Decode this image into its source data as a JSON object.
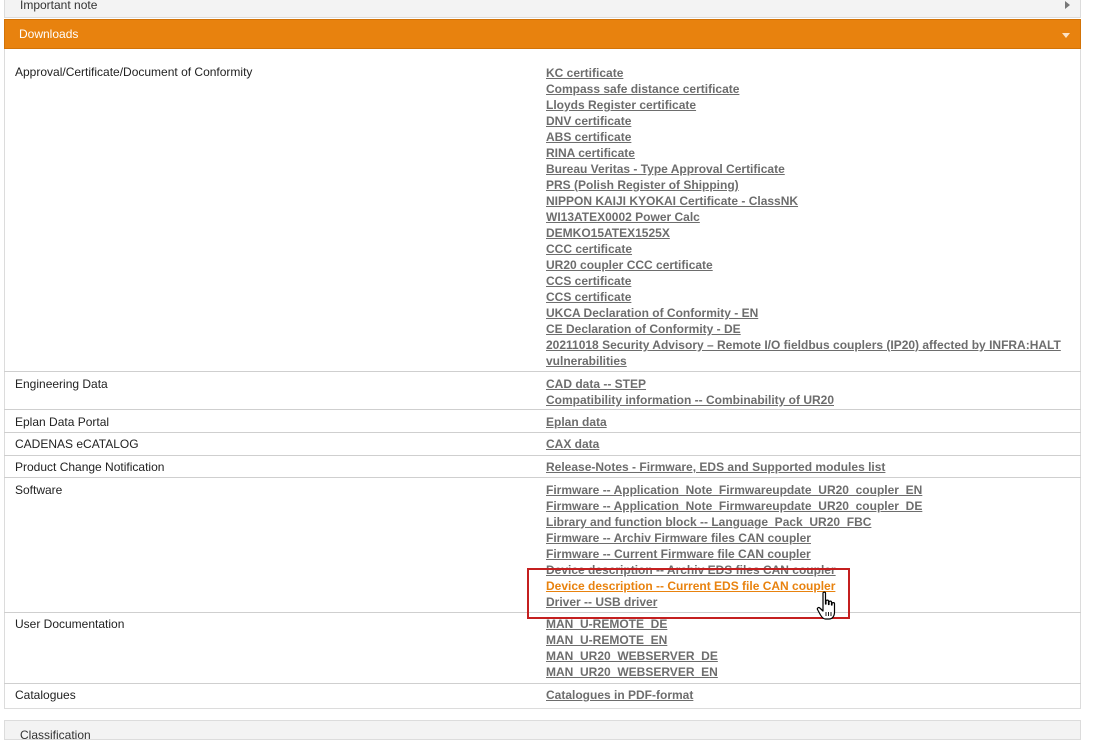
{
  "note_bar": {
    "label": "Important note"
  },
  "downloads_bar": {
    "label": "Downloads"
  },
  "rows": {
    "approval": {
      "label": "Approval/Certificate/Document of Conformity",
      "links": [
        "KC certificate",
        "Compass safe distance certificate",
        "Lloyds Register certificate",
        "DNV certificate",
        "ABS certificate",
        "RINA certificate",
        "Bureau Veritas - Type Approval Certificate",
        "PRS (Polish Register of Shipping)",
        "NIPPON KAIJI KYOKAI Certificate - ClassNK",
        "WI13ATEX0002 Power Calc",
        "DEMKO15ATEX1525X",
        "CCC certificate",
        "UR20 coupler CCC certificate",
        "CCS certificate",
        "CCS certificate",
        "UKCA Declaration of Conformity - EN",
        "CE Declaration of Conformity - DE",
        "20211018 Security Advisory – Remote I/O fieldbus couplers (IP20) affected by INFRA:HALT vulnerabilities"
      ]
    },
    "engineering": {
      "label": "Engineering Data",
      "links": [
        "CAD data -- STEP",
        "Compatibility information -- Combinability of UR20"
      ]
    },
    "eplan": {
      "label": "Eplan Data Portal",
      "links": [
        "Eplan data"
      ]
    },
    "cadenas": {
      "label": "CADENAS eCATALOG",
      "links": [
        "CAX data"
      ]
    },
    "pcn": {
      "label": "Product Change Notification",
      "links": [
        "Release-Notes - Firmware, EDS and Supported modules list"
      ]
    },
    "software": {
      "label": "Software",
      "links": [
        "Firmware -- Application_Note_Firmwareupdate_UR20_coupler_EN",
        "Firmware -- Application_Note_Firmwareupdate_UR20_coupler_DE",
        "Library and function block -- Language_Pack_UR20_FBC",
        "Firmware -- Archiv Firmware files CAN coupler",
        "Firmware -- Current Firmware file CAN coupler",
        "Device description -- Archiv EDS files CAN coupler",
        "Device description -- Current EDS file CAN coupler",
        "Driver -- USB driver"
      ]
    },
    "userdoc": {
      "label": "User Documentation",
      "links": [
        "MAN_U-REMOTE_DE",
        "MAN_U-REMOTE_EN",
        "MAN_UR20_WEBSERVER_DE",
        "MAN_UR20_WEBSERVER_EN"
      ]
    },
    "catalogues": {
      "label": "Catalogues",
      "links": [
        "Catalogues in PDF-format"
      ]
    }
  },
  "bottom_bar": {
    "label": "Classification"
  },
  "colors": {
    "accent": "#e8820e",
    "link": "#6d6d6d",
    "highlight_box": "#c41f1f"
  },
  "icons": {
    "cursor": "hand-pointer-icon",
    "expand": "chevron-down-icon",
    "collapsed": "chevron-right-icon"
  }
}
